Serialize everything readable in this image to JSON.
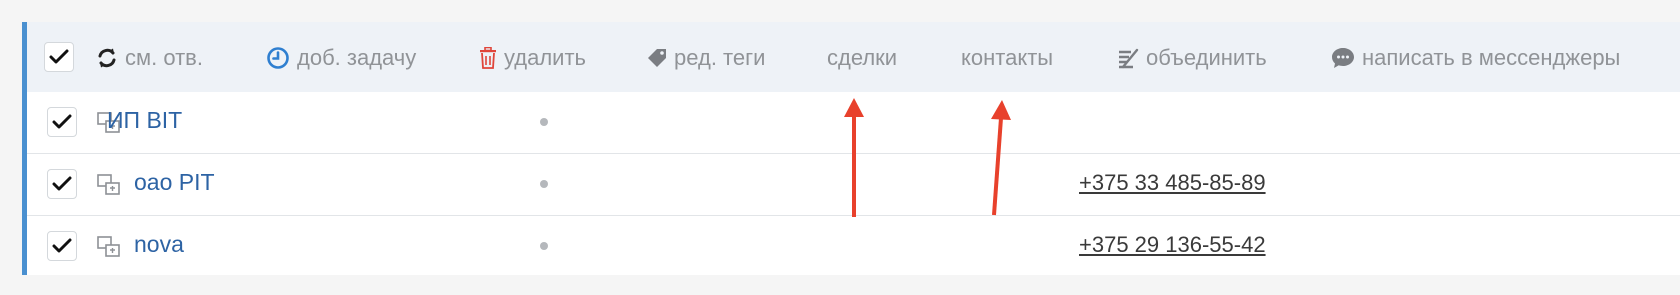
{
  "toolbar": {
    "items": [
      {
        "label": "см. отв.",
        "icon": "refresh-icon",
        "color": "#222222"
      },
      {
        "label": "доб. задачу",
        "icon": "clock-icon",
        "color": "#2f7fd0"
      },
      {
        "label": "удалить",
        "icon": "trash-icon",
        "color": "#e0453a"
      },
      {
        "label": "ред. теги",
        "icon": "tag-icon",
        "color": "#7a7d82"
      },
      {
        "label": "сделки",
        "icon": "",
        "color": ""
      },
      {
        "label": "контакты",
        "icon": "",
        "color": ""
      },
      {
        "label": "объединить",
        "icon": "merge-icon",
        "color": "#7a7d82"
      },
      {
        "label": "написать в мессенджеры",
        "icon": "chat-bubble-icon",
        "color": "#7a7d82"
      }
    ]
  },
  "rows": [
    {
      "name": "ИП BIT",
      "phone": ""
    },
    {
      "name": "оао PIT",
      "phone": "+375 33 485-85-89"
    },
    {
      "name": "nova",
      "phone": "+375 29 136-55-42"
    }
  ],
  "colors": {
    "accent": "#4a90d0",
    "link": "#2d63a4",
    "annotation_arrow": "#e8412c"
  }
}
